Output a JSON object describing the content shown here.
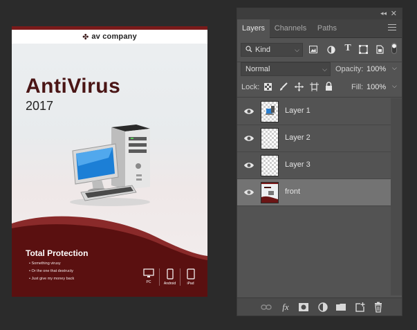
{
  "document": {
    "brand_mark": "✤",
    "brand_name": "av company",
    "title": "AntiVirus",
    "year": "2017",
    "protection_heading": "Total Protection",
    "bullets": [
      "Something virusy",
      "Or the one that destructy",
      "Just give my money back"
    ],
    "devices": [
      {
        "label": "PC",
        "icon": "monitor-icon"
      },
      {
        "label": "Android",
        "icon": "phone-icon"
      },
      {
        "label": "iPad",
        "icon": "tablet-icon"
      }
    ]
  },
  "panel": {
    "collapse_glyph": "◂◂",
    "close_glyph": "✕",
    "tabs": [
      {
        "label": "Layers",
        "active": true
      },
      {
        "label": "Channels",
        "active": false
      },
      {
        "label": "Paths",
        "active": false
      }
    ],
    "filter": {
      "value": "Kind",
      "icon": "search-icon"
    },
    "filter_icons": [
      "image-filter-icon",
      "adjustment-filter-icon",
      "type-filter-icon",
      "shape-filter-icon",
      "smart-object-filter-icon",
      "filter-toggle-icon"
    ],
    "blend_mode": "Normal",
    "opacity": {
      "label": "Opacity:",
      "value": "100%"
    },
    "lock": {
      "label": "Lock:",
      "icons": [
        "lock-transparent-icon",
        "lock-paint-icon",
        "lock-position-icon",
        "lock-artboard-icon",
        "lock-all-icon"
      ]
    },
    "fill": {
      "label": "Fill:",
      "value": "100%"
    },
    "layers": [
      {
        "name": "Layer 1",
        "visible": true,
        "selected": false
      },
      {
        "name": "Layer 2",
        "visible": true,
        "selected": false
      },
      {
        "name": "Layer 3",
        "visible": true,
        "selected": false
      },
      {
        "name": "front",
        "visible": true,
        "selected": true
      }
    ],
    "footer_icons": [
      "link-layers-icon",
      "fx-icon",
      "mask-icon",
      "adjustment-layer-icon",
      "new-group-icon",
      "new-layer-icon",
      "delete-icon"
    ],
    "colors": {
      "panel_bg": "#535353",
      "selected_layer": "#737373",
      "accent_red": "#7a1a1a"
    }
  }
}
